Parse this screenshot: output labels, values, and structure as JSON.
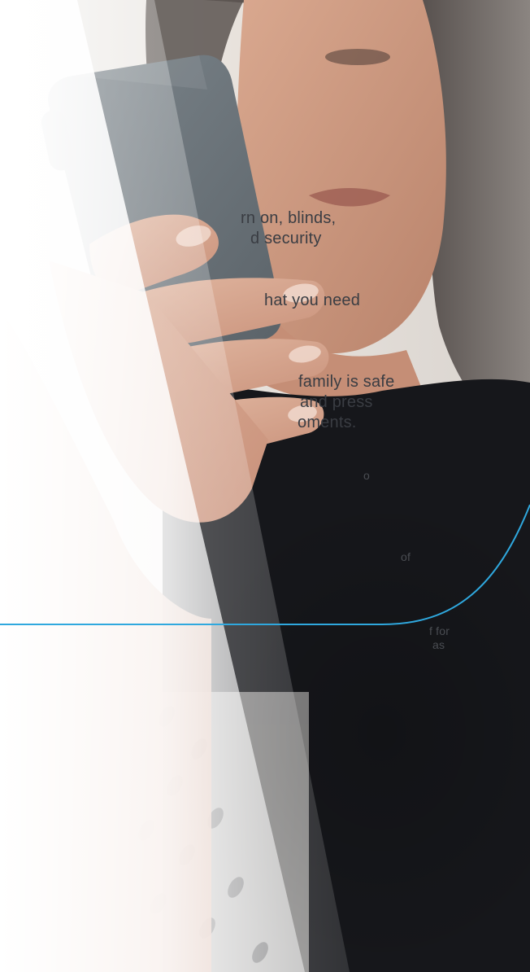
{
  "body_text": {
    "p1_line1": "rn on, blinds,",
    "p1_line2": "d security",
    "p2_line1": "hat you need",
    "p3_line1": "family is safe",
    "p3_line2": "and press",
    "p3_line3": "oments.",
    "frag1": "o",
    "frag2": "of",
    "frag3_line1": "f for",
    "frag3_line2": "as"
  },
  "colors": {
    "accent_curve": "#2fa8de",
    "text": "#3a3d43"
  }
}
